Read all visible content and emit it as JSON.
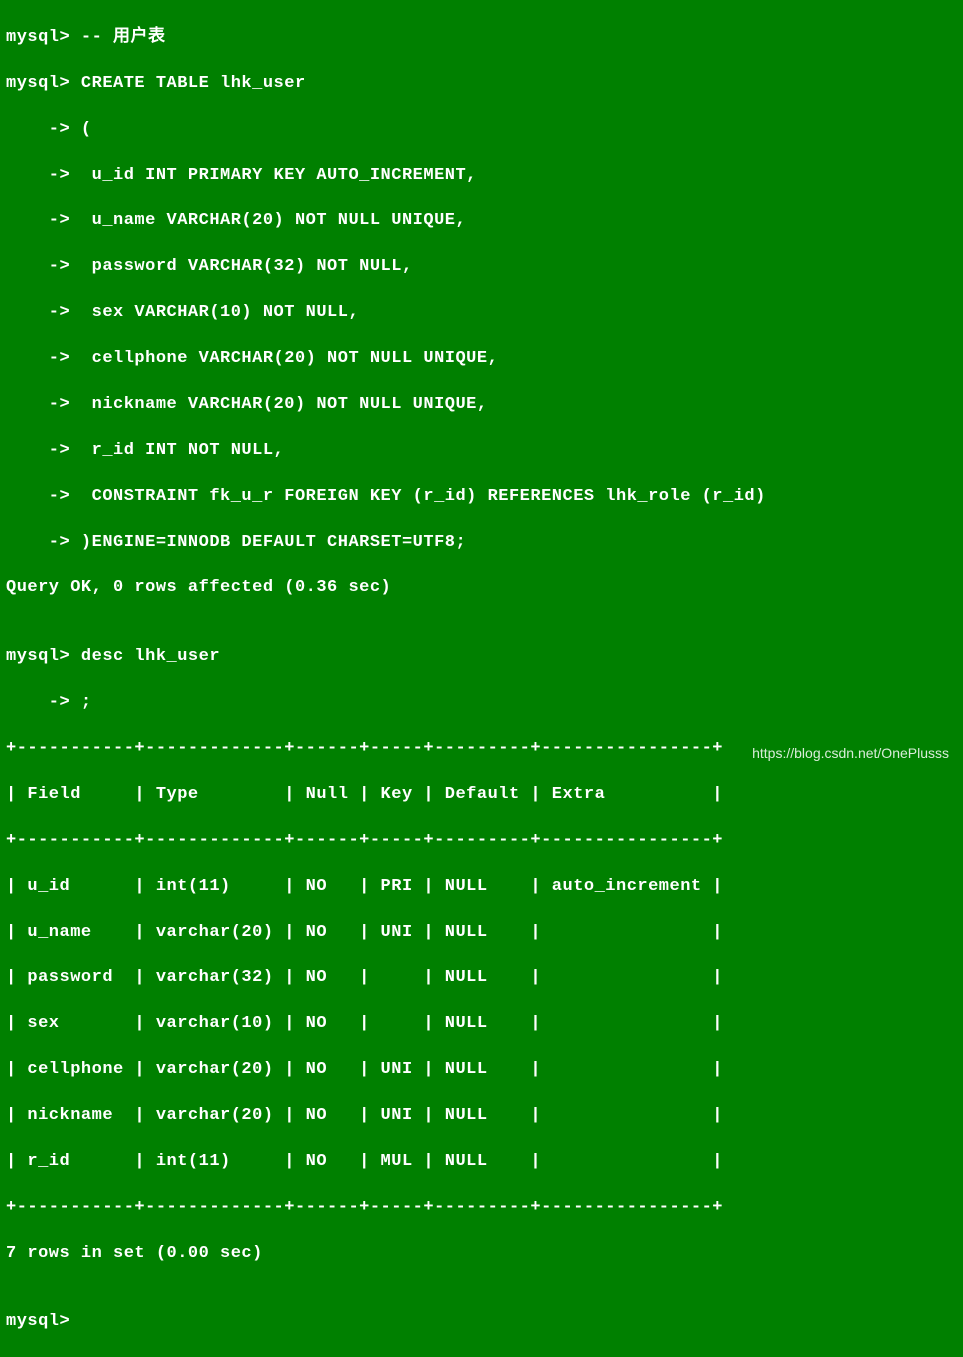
{
  "lines": {
    "l1": "mysql> -- 用户表",
    "l2": "mysql> CREATE TABLE lhk_user",
    "l3": "    -> (",
    "l4": "    ->  u_id INT PRIMARY KEY AUTO_INCREMENT,",
    "l5": "    ->  u_name VARCHAR(20) NOT NULL UNIQUE,",
    "l6": "    ->  password VARCHAR(32) NOT NULL,",
    "l7": "    ->  sex VARCHAR(10) NOT NULL,",
    "l8": "    ->  cellphone VARCHAR(20) NOT NULL UNIQUE,",
    "l9": "    ->  nickname VARCHAR(20) NOT NULL UNIQUE,",
    "l10": "    ->  r_id INT NOT NULL,",
    "l11": "    ->  CONSTRAINT fk_u_r FOREIGN KEY (r_id) REFERENCES lhk_role (r_id)",
    "l12": "    -> )ENGINE=INNODB DEFAULT CHARSET=UTF8;",
    "l13": "Query OK, 0 rows affected (0.36 sec)",
    "l14": "",
    "l15": "mysql> desc lhk_user",
    "l16": "    -> ;",
    "l17": "+-----------+-------------+------+-----+---------+----------------+",
    "l18": "| Field     | Type        | Null | Key | Default | Extra          |",
    "l19": "+-----------+-------------+------+-----+---------+----------------+",
    "l20": "| u_id      | int(11)     | NO   | PRI | NULL    | auto_increment |",
    "l21": "| u_name    | varchar(20) | NO   | UNI | NULL    |                |",
    "l22": "| password  | varchar(32) | NO   |     | NULL    |                |",
    "l23": "| sex       | varchar(10) | NO   |     | NULL    |                |",
    "l24": "| cellphone | varchar(20) | NO   | UNI | NULL    |                |",
    "l25": "| nickname  | varchar(20) | NO   | UNI | NULL    |                |",
    "l26": "| r_id      | int(11)     | NO   | MUL | NULL    |                |",
    "l27": "+-----------+-------------+------+-----+---------+----------------+",
    "l28": "7 rows in set (0.00 sec)",
    "l29": "",
    "l30": "mysql>"
  },
  "chart_data": {
    "type": "table",
    "title": "desc lhk_user",
    "columns": [
      "Field",
      "Type",
      "Null",
      "Key",
      "Default",
      "Extra"
    ],
    "rows": [
      {
        "Field": "u_id",
        "Type": "int(11)",
        "Null": "NO",
        "Key": "PRI",
        "Default": "NULL",
        "Extra": "auto_increment"
      },
      {
        "Field": "u_name",
        "Type": "varchar(20)",
        "Null": "NO",
        "Key": "UNI",
        "Default": "NULL",
        "Extra": ""
      },
      {
        "Field": "password",
        "Type": "varchar(32)",
        "Null": "NO",
        "Key": "",
        "Default": "NULL",
        "Extra": ""
      },
      {
        "Field": "sex",
        "Type": "varchar(10)",
        "Null": "NO",
        "Key": "",
        "Default": "NULL",
        "Extra": ""
      },
      {
        "Field": "cellphone",
        "Type": "varchar(20)",
        "Null": "NO",
        "Key": "UNI",
        "Default": "NULL",
        "Extra": ""
      },
      {
        "Field": "nickname",
        "Type": "varchar(20)",
        "Null": "NO",
        "Key": "UNI",
        "Default": "NULL",
        "Extra": ""
      },
      {
        "Field": "r_id",
        "Type": "int(11)",
        "Null": "NO",
        "Key": "MUL",
        "Default": "NULL",
        "Extra": ""
      }
    ]
  },
  "watermark": "https://blog.csdn.net/OnePlusss"
}
